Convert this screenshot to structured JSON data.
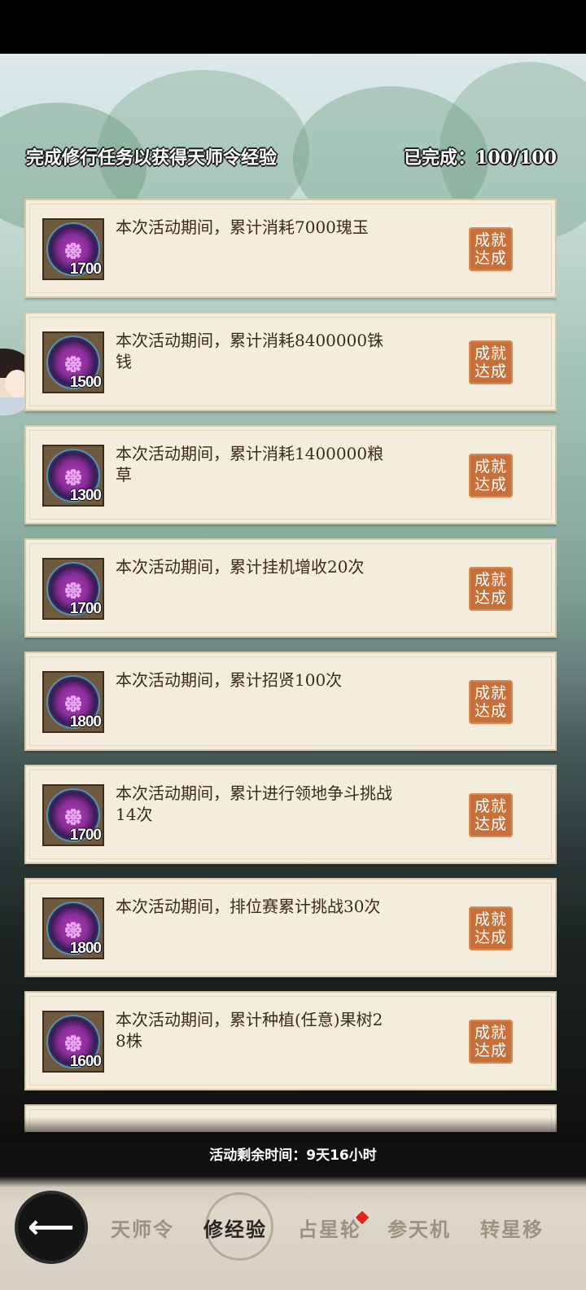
{
  "header": {
    "instruction": "完成修行任务以获得天师令经验",
    "progress": "已完成：100/100"
  },
  "tasks": [
    {
      "description": "本次活动期间，累计消耗7000瑰玉",
      "exp": "1700",
      "status": "成就达成"
    },
    {
      "description": "本次活动期间，累计消耗8400000铢钱",
      "exp": "1500",
      "status": "成就达成"
    },
    {
      "description": "本次活动期间，累计消耗1400000粮草",
      "exp": "1300",
      "status": "成就达成"
    },
    {
      "description": "本次活动期间，累计挂机增收20次",
      "exp": "1700",
      "status": "成就达成"
    },
    {
      "description": "本次活动期间，累计招贤100次",
      "exp": "1800",
      "status": "成就达成"
    },
    {
      "description": "本次活动期间，累计进行领地争斗挑战14次",
      "exp": "1700",
      "status": "成就达成"
    },
    {
      "description": "本次活动期间，排位赛累计挑战30次",
      "exp": "1800",
      "status": "成就达成"
    },
    {
      "description": "本次活动期间，累计种植(任意)果树28株",
      "exp": "1600",
      "status": "成就达成"
    }
  ],
  "timer": "活动剩余时间：9天16小时",
  "nav": {
    "tabs": [
      "天师令",
      "修经验",
      "占星轮",
      "参天机",
      "转星移"
    ],
    "active": "修经验"
  },
  "icons": {
    "back": "back-arrow-icon",
    "exp_medal": "exp-medal-icon",
    "notification": "red-dot-icon"
  },
  "colors": {
    "card_bg": "#f4ecdc",
    "badge": "#c8703a",
    "text": "#3b2a1d"
  }
}
